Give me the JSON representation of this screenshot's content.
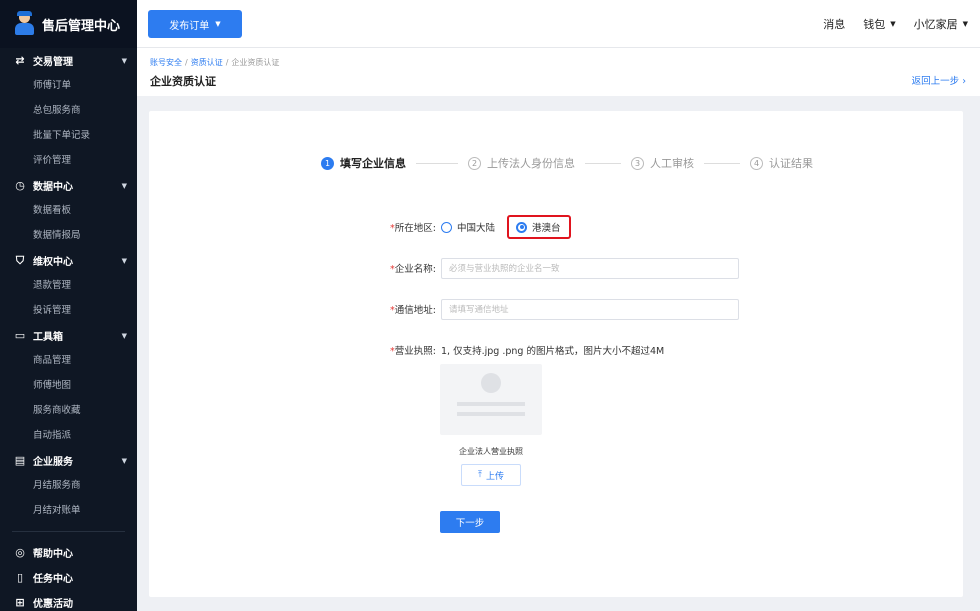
{
  "app": {
    "title": "售后管理中心"
  },
  "sidebar": {
    "groups": [
      {
        "label": "交易管理",
        "icon": "swap-icon",
        "items": [
          "师傅订单",
          "总包服务商",
          "批量下单记录",
          "评价管理"
        ]
      },
      {
        "label": "数据中心",
        "icon": "clock-icon",
        "items": [
          "数据看板",
          "数据情报局"
        ]
      },
      {
        "label": "维权中心",
        "icon": "shield-icon",
        "items": [
          "退款管理",
          "投诉管理"
        ]
      },
      {
        "label": "工具箱",
        "icon": "toolbox-icon",
        "items": [
          "商品管理",
          "师傅地图",
          "服务商收藏",
          "自动指派"
        ]
      },
      {
        "label": "企业服务",
        "icon": "building-icon",
        "items": [
          "月结服务商",
          "月结对账单"
        ]
      }
    ],
    "bottom": [
      {
        "label": "帮助中心",
        "icon": "help-icon"
      },
      {
        "label": "任务中心",
        "icon": "task-icon"
      },
      {
        "label": "优惠活动",
        "icon": "gift-icon"
      }
    ]
  },
  "topbar": {
    "publish_label": "发布订单",
    "messages": "消息",
    "wallet": "钱包",
    "user": "小忆家居"
  },
  "header": {
    "breadcrumb": [
      "账号安全",
      "资质认证",
      "企业资质认证"
    ],
    "title": "企业资质认证",
    "back": "返回上一步"
  },
  "steps": [
    {
      "num": "1",
      "label": "填写企业信息",
      "active": true
    },
    {
      "num": "2",
      "label": "上传法人身份信息",
      "active": false
    },
    {
      "num": "3",
      "label": "人工审核",
      "active": false
    },
    {
      "num": "4",
      "label": "认证结果",
      "active": false
    }
  ],
  "form": {
    "region": {
      "label": "所在地区:",
      "options": [
        "中国大陆",
        "港澳台"
      ],
      "selected": "港澳台"
    },
    "company_name": {
      "label": "企业名称:",
      "placeholder": "必须与营业执照的企业名一致"
    },
    "address": {
      "label": "通信地址:",
      "placeholder": "请填写通信地址"
    },
    "license": {
      "label": "营业执照:",
      "note": "1, 仅支持.jpg .png 的图片格式，图片大小不超过4M"
    },
    "upload_caption": "企业法人营业执照",
    "upload_label": "上传",
    "next_label": "下一步"
  },
  "colors": {
    "accent": "#2d7cf0",
    "sidebar_bg": "#0f1724",
    "highlight": "#e0141e",
    "required": "#e53935"
  }
}
